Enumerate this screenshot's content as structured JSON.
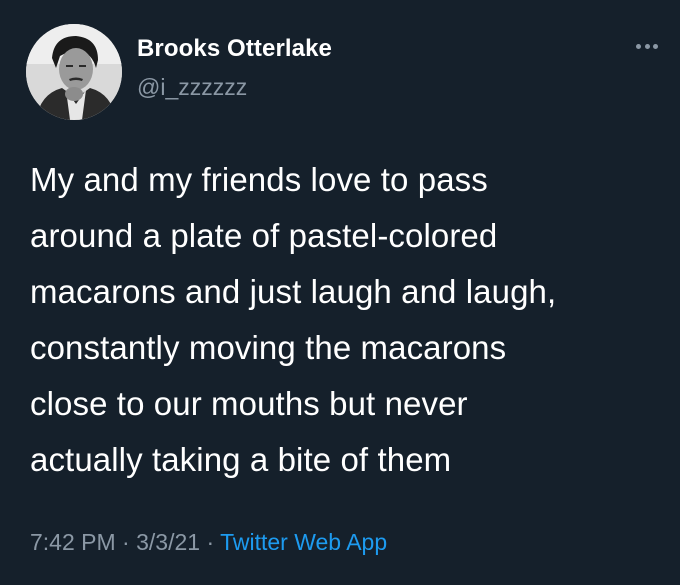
{
  "author": {
    "display_name": "Brooks Otterlake",
    "handle": "@i_zzzzzz",
    "avatar_icon": "profile-photo"
  },
  "more_icon": "more-horizontal-icon",
  "tweet": {
    "lines": [
      "My and my friends love to pass",
      "around a plate of pastel-colored",
      "macarons and just laugh and laugh,",
      "constantly moving the macarons",
      "close to our mouths but never",
      "actually taking a bite of them"
    ]
  },
  "meta": {
    "time": "7:42 PM",
    "separator": " · ",
    "date": "3/3/21",
    "separator2": " · ",
    "source": "Twitter Web App"
  },
  "colors": {
    "background": "#15202b",
    "text": "#ffffff",
    "secondary": "#8b98a5",
    "link": "#1d9bf0"
  }
}
